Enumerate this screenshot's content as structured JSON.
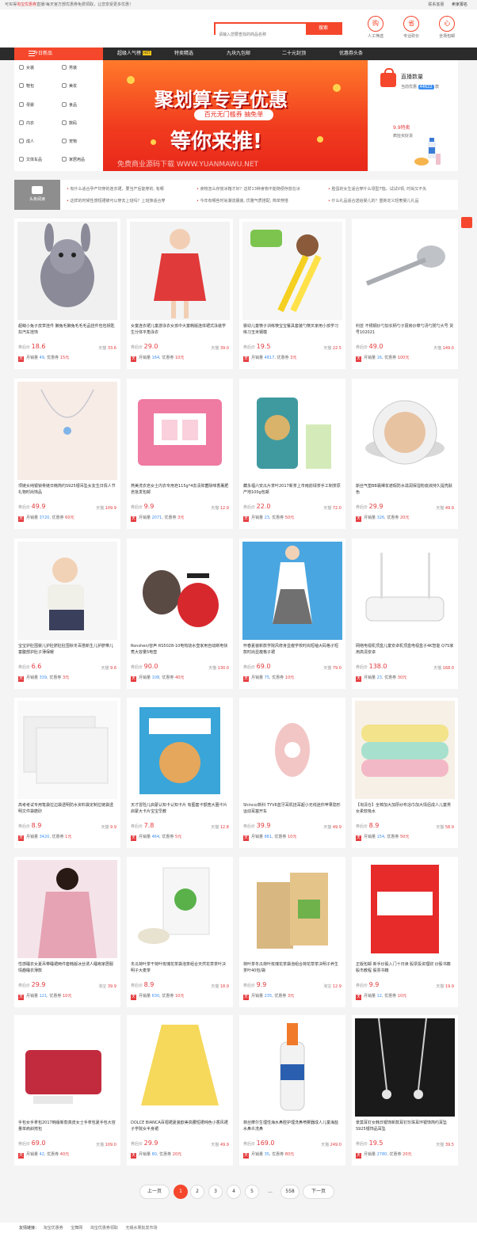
{
  "topbar": {
    "left_prefix": "可买得",
    "left_hl": "淘宝优惠券",
    "left_suffix": "直播!每天官方部优惠券免费领取，让您享受更多优惠！",
    "right": [
      "联系客服",
      "卖家报名"
    ]
  },
  "search": {
    "placeholder": "请输入您要查找的商品名称",
    "button": "搜索"
  },
  "header_icons": [
    {
      "glyph": "购",
      "label": "人工筛选"
    },
    {
      "glyph": "省",
      "label": "专业砍价"
    },
    {
      "glyph": "心",
      "label": "全场包邮"
    }
  ],
  "nav": {
    "category": "今日新品",
    "items": [
      "超级人气榜",
      "特卖精选",
      "九块九包邮",
      "二十元封顶",
      "优惠券头条"
    ],
    "hot_badge": "HOT"
  },
  "sidebar": [
    [
      "女装",
      "男装"
    ],
    [
      "鞋包",
      "美妆"
    ],
    [
      "母婴",
      "食品"
    ],
    [
      "内衣",
      "数码"
    ],
    [
      "成人",
      "宠物"
    ],
    [
      "文体车品",
      "家居用品"
    ]
  ],
  "banner": {
    "title": "聚划算专享优惠",
    "subtitle": "百元无门槛券 抽免单",
    "slogan": "等你来推!",
    "watermark": "免费商业源码下载 WWW.YUANMAWU.NET"
  },
  "live": {
    "title": "直播数量",
    "count_label": "当前优惠",
    "count": "44622",
    "unit": "款",
    "promo": "9.9特卖",
    "promo_sub": "疯狂买好货"
  },
  "news": {
    "label": "头条阅读",
    "left": [
      "有什么适合孕产妇穿的连衣裙，要当产后能穿的, 有哪",
      "这样的时候性感短裙被可以穿去上班吗？上班族适合穿"
    ],
    "mid": [
      "食物怎么存放冰箱才好？这样13种食物不能随便存放在冰",
      "今年有哪些时尚潮流服装, 优雅气质搭配, 简单穿搭"
    ],
    "right": [
      "脸蛋的女生适合穿什么领型T恤，试试V领, 时尚又不失",
      "什么礼品适合送给婴儿的？重新定义轻奢婴儿礼品"
    ]
  },
  "product_labels": {
    "coupon_price": "券后价",
    "monthly": "月销量",
    "coupon": "优惠券",
    "tmall": "天"
  },
  "products": [
    {
      "title": "超萌小兔子皮草挂件 獭兔毛獭兔毛毛毛品挂件包包钥匙扣汽车挂饰",
      "price": "18.6",
      "orig_label": "天猫",
      "orig": "33.6",
      "sales": "49",
      "coupon": "15元",
      "img": "rabbit"
    },
    {
      "title": "女童连衣裙儿童游泳衣女孩中大童韩版连体裙式泳装学生分体平角泳衣",
      "price": "29.0",
      "orig_label": "天猫",
      "orig": "39.0",
      "sales": "164",
      "coupon": "10元",
      "img": "girl"
    },
    {
      "title": "婴幼儿童筷子训练筷宝宝餐具套装勺筷叉家用小孩学习练习玉米钢模",
      "price": "19.5",
      "orig_label": "天猫",
      "orig": "22.5",
      "sales": "4817",
      "coupon": "3元",
      "img": "chopsticks"
    },
    {
      "title": "利芸 不锈钢炒勺加长柄勺子厨房炒菜勺汤勺粥勺大号 货号102021",
      "price": "49.0",
      "orig_label": "天猫",
      "orig": "149.0",
      "sales": "16",
      "coupon": "100元",
      "img": "ladle"
    },
    {
      "title": "项链女纯银锁骨链日韩简约S925银吊坠女友生日情人节礼物时尚饰品",
      "price": "49.9",
      "orig_label": "天猫",
      "orig": "109.9",
      "sales": "3720",
      "coupon": "60元",
      "img": "necklace"
    },
    {
      "title": "燕美洗衣皂女士内衣专用皂115g*4去渍抑菌除味香薰肥皂批发包邮",
      "price": "9.9",
      "orig_label": "天猫",
      "orig": "12.9",
      "sales": "2071",
      "coupon": "3元",
      "img": "soap"
    },
    {
      "title": "藏永福六安瓜片茶叶2017新茶上市雨前绿茶手工制茶原产地100g包邮",
      "price": "22.0",
      "orig_label": "天猫",
      "orig": "72.0",
      "sales": "23",
      "coupon": "50元",
      "img": "tea"
    },
    {
      "title": "斯丝气垫BB霜裸妆遮瑕防水滋润保湿粉底液持久提亮肤色",
      "price": "29.9",
      "orig_label": "天猫",
      "orig": "49.9",
      "sales": "326",
      "coupon": "20元",
      "img": "cushion"
    },
    {
      "title": "宝宝护肚围婴儿护肚脐肚肚围秋冬百搭新生儿护脐带儿童腹部护肚子薄保暖",
      "price": "6.6",
      "orig_label": "天猫",
      "orig": "9.6",
      "sales": "339",
      "coupon": "3元",
      "img": "baby"
    },
    {
      "title": "Ronshen/容声 RS5028-10电热烧水壶家用自动断电快煮大容量5电壶",
      "price": "90.0",
      "orig_label": "天猫",
      "orig": "130.0",
      "sales": "108",
      "coupon": "40元",
      "img": "kettle"
    },
    {
      "title": "怀春夏装新款学院风修身显瘦学校时尚短袖大码格子短款时尚显瘦格子裙",
      "price": "69.0",
      "orig_label": "天猫",
      "orig": "79.0",
      "sales": "75",
      "coupon": "10元",
      "img": "dress"
    },
    {
      "title": "网络电视机顶盒儿童安卓机顶盒电视盒子4K智能 Q7S家用高清安卓",
      "price": "138.0",
      "orig_label": "天猫",
      "orig": "168.0",
      "sales": "23",
      "coupon": "30元",
      "img": "router"
    },
    {
      "title": "高考考试专用笔袋拉边袋透明防水资料袋定制拉链袋透明文件袋磨砂",
      "price": "8.9",
      "orig_label": "天猫",
      "orig": "9.9",
      "sales": "3420",
      "coupon": "1元",
      "img": "bags"
    },
    {
      "title": "天才冒险儿启蒙认知卡认知卡片 有图套卡额宽大圈卡片启蒙大卡片宝宝早教",
      "price": "7.8",
      "orig_label": "天猫",
      "orig": "12.8",
      "sales": "464",
      "coupon": "5元",
      "img": "book"
    },
    {
      "title": "Shinco/新科 TYV6蓝牙耳机挂耳超小无线迷你苹果隐形运动耳塞开车",
      "price": "39.9",
      "orig_label": "天猫",
      "orig": "49.9",
      "sales": "861",
      "coupon": "10元",
      "img": "earbud"
    },
    {
      "title": "【淘清仓】全棉加大加厚纱布浴巾加大情侣成人儿童男女柔软吸水",
      "price": "8.9",
      "orig_label": "天猫",
      "orig": "58.9",
      "sales": "154",
      "coupon": "50元",
      "img": "towels"
    },
    {
      "title": "性感睡衣女夏吊带睡裙两件套韩版冰丝诱人睡袍家居服情趣睡衣薄款",
      "price": "29.9",
      "orig_label": "淘宝",
      "orig": "39.9",
      "sales": "121",
      "coupon": "10元",
      "img": "robe"
    },
    {
      "title": "冬瓜荷叶茶干荷叶玫瑰花茶袋泡茶组合天然花草茶叶决明子大麦茶",
      "price": "8.9",
      "orig_label": "天猫",
      "orig": "18.9",
      "sales": "630",
      "coupon": "10元",
      "img": "herbtea"
    },
    {
      "title": "荷叶茶冬瓜荷叶玫瑰花茶袋泡组合荷花草茶决明子养生茶叶40包/袋",
      "price": "9.9",
      "orig_label": "淘宝",
      "orig": "12.9",
      "sales": "235",
      "coupon": "3元",
      "img": "herbbag"
    },
    {
      "title": "正版包邮 新手炒股入门十日读 股票投资理财 炒股书籍 股市教程 股票书籍",
      "price": "9.9",
      "orig_label": "天猫",
      "orig": "19.9",
      "sales": "12",
      "coupon": "10元",
      "img": "stockbook"
    },
    {
      "title": "手包女手拿包2017韩版新款真皮女士手拿包夏手包大容量单肩斜挎包",
      "price": "69.0",
      "orig_label": "天猫",
      "orig": "109.0",
      "sales": "42",
      "coupon": "40元",
      "img": "clutch"
    },
    {
      "title": "DOLCE BIANCA百褶裙夏装欧美高腰短裙纯色小香风裙子学院女半身裙",
      "price": "29.9",
      "orig_label": "天猫",
      "orig": "49.9",
      "sales": "80",
      "coupon": "20元",
      "img": "skirt"
    },
    {
      "title": "菲丝摩尔生理性海水鼻腔护理洗鼻喷雾器成人儿童海盐水鼻炎洗鼻",
      "price": "169.0",
      "orig_label": "天猫",
      "orig": "249.0",
      "sales": "35",
      "coupon": "80元",
      "img": "spray"
    },
    {
      "title": "景莫耳钉女韩日银饰新款耳钉珍珠耳环银饰简约耳坠S925银饰品耳坠",
      "price": "19.5",
      "orig_label": "天猫",
      "orig": "39.5",
      "sales": "2780",
      "coupon": "20元",
      "img": "earrings"
    }
  ],
  "pager": {
    "prev": "上一页",
    "pages": [
      "1",
      "2",
      "3",
      "4",
      "5"
    ],
    "ellipsis": "...",
    "last": "558",
    "next": "下一页",
    "current": "1"
  },
  "links": {
    "label": "友情链接：",
    "items": [
      "淘宝优惠券",
      "宝舞网",
      "淘宝优惠券领取",
      "无锡水果批发市场"
    ]
  },
  "colors": {
    "accent": "#f5472c",
    "price": "#e4393c",
    "nav_bg": "#2b2b2b"
  }
}
